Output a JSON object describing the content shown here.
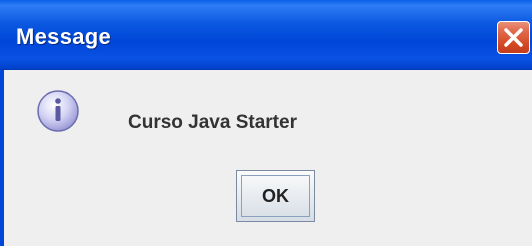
{
  "window": {
    "title": "Message",
    "close_icon": "close-icon"
  },
  "dialog": {
    "icon": "info-icon",
    "message": "Curso Java Starter",
    "ok_label": "OK"
  },
  "colors": {
    "titlebar": "#0a57e0",
    "body": "#efefef",
    "close_button": "#d44a26",
    "icon_fill": "#c8c8f0"
  }
}
